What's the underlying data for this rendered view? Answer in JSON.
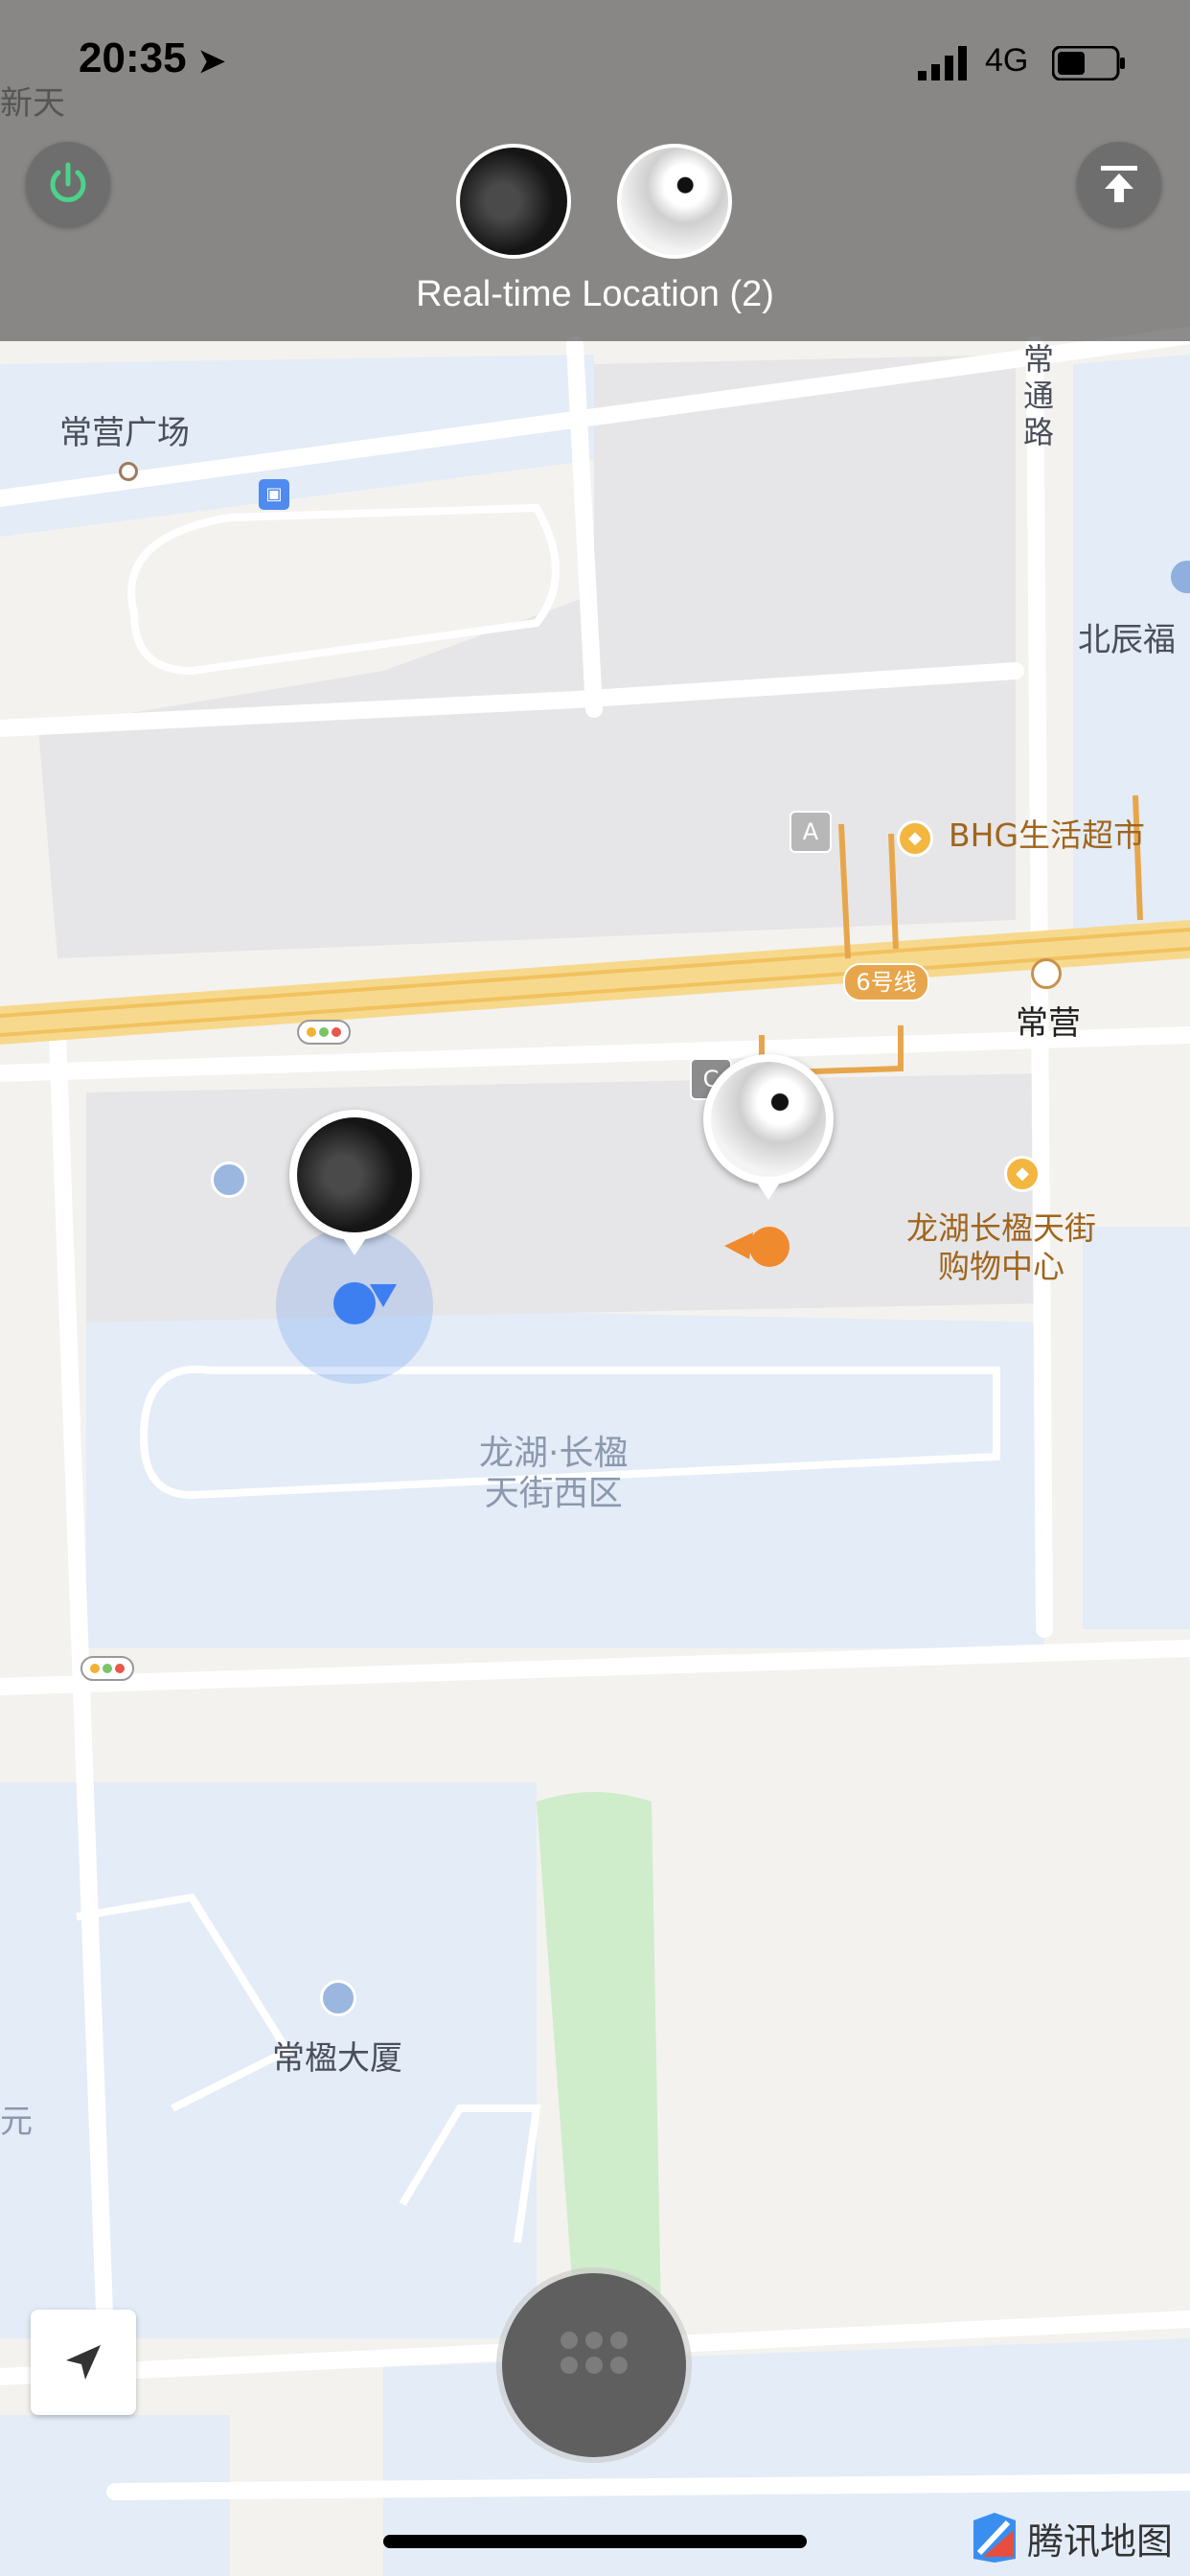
{
  "status_bar": {
    "time": "20:35",
    "network": "4G"
  },
  "header": {
    "title": "Real-time Location (2)"
  },
  "map": {
    "labels": {
      "changying_square": "常营广场",
      "changtong_road": "常通路",
      "beichen": "北辰福",
      "bhg": "BHG生活超市",
      "changying": "常营",
      "metro_line": "6号线",
      "longhu_mall": "龙湖长楹天街\n购物中心",
      "longhu_west": "龙湖·长楹\n天街西区",
      "changying_building": "常楹大厦",
      "top_left_partial": "新天",
      "left_partial": "元",
      "gate_a": "A",
      "gate_c": "C"
    }
  },
  "brand": {
    "name": "腾讯地图"
  },
  "icons": {
    "power": "power-icon",
    "upload": "upload-top-icon",
    "locate": "navigation-arrow-icon",
    "menu": "grid-dots-icon"
  },
  "colors": {
    "power_green": "#4cd28a",
    "self_blue": "#3d7ff0",
    "other_orange": "#f08a2e"
  }
}
